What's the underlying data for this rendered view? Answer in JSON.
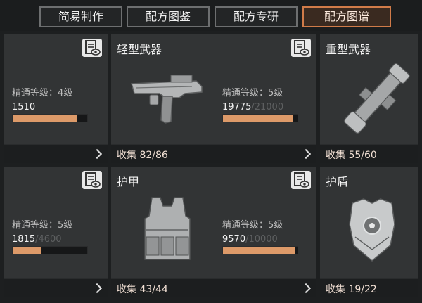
{
  "tabs": [
    {
      "label": "简易制作",
      "active": false
    },
    {
      "label": "配方图鉴",
      "active": false
    },
    {
      "label": "配方专研",
      "active": false
    },
    {
      "label": "配方图谱",
      "active": true
    }
  ],
  "colors": {
    "accent": "#dd9a69",
    "active_border": "#d07b49",
    "card": "#323435"
  },
  "cards": {
    "partial_top": {
      "level": "精通等级：4级",
      "progress": "1510",
      "fill": 0.87
    },
    "light_weapon": {
      "title": "轻型武器",
      "icon": "submachine-gun",
      "collect": "收集 82/86",
      "level": "精通等级：5级",
      "progress": "19775",
      "max": "/21000",
      "fill": 0.94
    },
    "heavy_weapon": {
      "title": "重型武器",
      "icon": "rocket-launcher",
      "collect": "收集 55/60"
    },
    "partial_bottom": {
      "level": "精通等级：5级",
      "progress": "1815",
      "max": "/4600",
      "fill": 0.39
    },
    "armor": {
      "title": "护甲",
      "icon": "tactical-vest",
      "collect": "收集 43/44",
      "level": "精通等级：5级",
      "progress": "9570",
      "max": "/10000",
      "fill": 0.96
    },
    "shield": {
      "title": "护盾",
      "icon": "chest-shield",
      "collect": "收集 19/22"
    }
  }
}
